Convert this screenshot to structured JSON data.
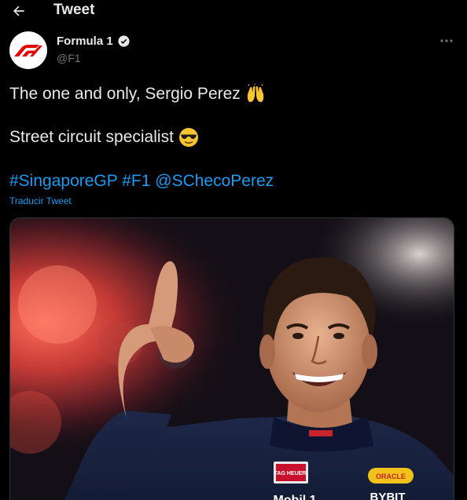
{
  "topbar": {
    "title": "Tweet",
    "back_icon": "arrow-left-icon"
  },
  "author": {
    "name": "Formula 1",
    "handle": "@F1",
    "verified": true,
    "avatar_icon": "f1-logo-icon",
    "more_icon": "ellipsis-icon"
  },
  "tweet": {
    "line1": "The one and only, Sergio Perez",
    "line1_emoji": "raising-hands-emoji",
    "line2": "Street circuit specialist",
    "line2_emoji": "sunglasses-face-emoji",
    "hashtag1": "#SingaporeGP",
    "hashtag2": "#F1",
    "mention": "@SChecoPerez",
    "translate": "Traducir Tweet"
  },
  "media": {
    "patch_text": "TAG HEUER",
    "sponsor1": "Mobil 1",
    "sponsor2": "BYBIT",
    "badge": "ORACLE"
  },
  "colors": {
    "link": "#1d9bf0",
    "background": "#000000",
    "text": "#e7e9ea",
    "muted": "#71767b"
  }
}
